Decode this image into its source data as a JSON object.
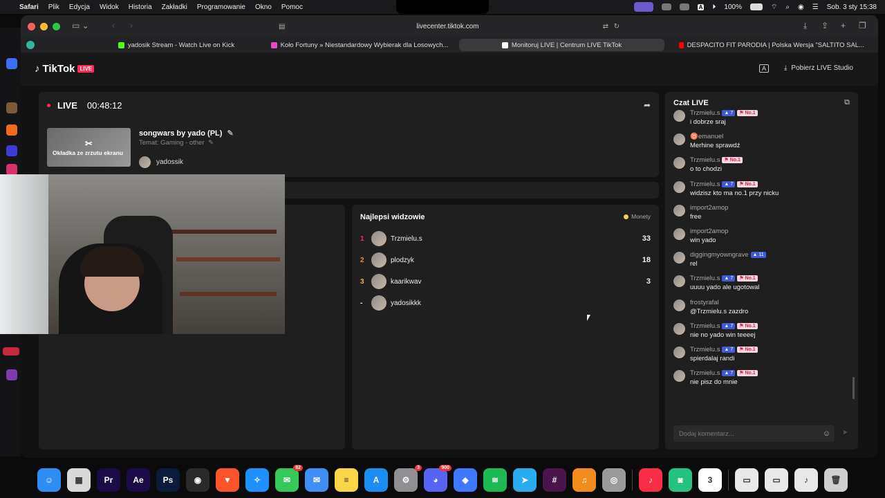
{
  "menubar": {
    "app": "Safari",
    "items": [
      "Plik",
      "Edycja",
      "Widok",
      "Historia",
      "Zakładki",
      "Programowanie",
      "Okno",
      "Pomoc"
    ],
    "battery": "100%",
    "datetime": "Sob. 3 sty 15:38"
  },
  "browser": {
    "url": "livecenter.tiktok.com",
    "tabs": [
      {
        "label": "yadosik Stream - Watch Live on Kick",
        "color": "#53fc18"
      },
      {
        "label": "Koło Fortuny » Niestandardowy Wybierak dla Losowych...",
        "color": "#e84ac2"
      },
      {
        "label": "Monitoruj LIVE | Centrum LIVE TikTok",
        "color": "#ffffff"
      },
      {
        "label": "DESPACITO FIT PARODIA | Polska Wersja \"SALTITO SAL...",
        "color": "#ff0000"
      }
    ]
  },
  "header": {
    "brand": "TikTok",
    "brand_badge": "LIVE",
    "download_label": "Pobierz LIVE Studio"
  },
  "live_panel": {
    "status": "LIVE",
    "timer": "00:48:12",
    "thumbnail_label": "Okładka ze zrzutu ekranu",
    "title": "songwars by yado (PL)",
    "topic": "Temat: Gaming - other",
    "username": "yadossik"
  },
  "top_viewers": {
    "title": "Najlepsi widzowie",
    "coins_label": "Monety",
    "rows": [
      {
        "rank": "1",
        "name": "Trzmielu.s",
        "score": "33",
        "rank_color": "#fe2c55"
      },
      {
        "rank": "2",
        "name": "plodzyk",
        "score": "18",
        "rank_color": "#ff8a3d"
      },
      {
        "rank": "3",
        "name": "kaarikwav",
        "score": "3",
        "rank_color": "#f5b82e"
      },
      {
        "rank": "-",
        "name": "yadosikkk",
        "score": "",
        "rank_color": "#ffffff"
      }
    ]
  },
  "chat": {
    "title": "Czat LIVE",
    "placeholder": "Dodaj komentarz...",
    "messages": [
      {
        "user": "Trzmielu.s",
        "level": "7",
        "badge": "No.1",
        "text": "i dobrze sraj"
      },
      {
        "user": "♉emanuel",
        "level": "",
        "badge": "",
        "text": "Merhine sprawdź"
      },
      {
        "user": "Trzmielu.s",
        "level": "",
        "badge": "No.1",
        "text": "o to chodzi"
      },
      {
        "user": "Trzmielu.s",
        "level": "7",
        "badge": "No.1",
        "text": "widzisz kto ma no.1 przy nicku"
      },
      {
        "user": "import2amop",
        "level": "",
        "badge": "",
        "text": "free"
      },
      {
        "user": "import2amop",
        "level": "",
        "badge": "",
        "text": "win yado"
      },
      {
        "user": "diggingmyowngrave",
        "level": "11",
        "badge": "",
        "text": "rel"
      },
      {
        "user": "Trzmielu.s",
        "level": "7",
        "badge": "No.1",
        "text": "uuuu yado ale ugotowal"
      },
      {
        "user": "frostyrafal",
        "level": "",
        "badge": "",
        "text": "@Trzmielu.s zazdro"
      },
      {
        "user": "Trzmielu.s",
        "level": "7",
        "badge": "No.1",
        "text": "nie no yado win teeeej"
      },
      {
        "user": "Trzmielu.s",
        "level": "7",
        "badge": "No.1",
        "text": "spierdalaj randi"
      },
      {
        "user": "Trzmielu.s",
        "level": "7",
        "badge": "No.1",
        "text": "nie pisz do mnie"
      }
    ]
  },
  "dock": {
    "apps": [
      {
        "name": "finder",
        "glyph": "☺",
        "color": "#2f8ef5"
      },
      {
        "name": "launchpad",
        "glyph": "▦",
        "color": "#d9d9d9"
      },
      {
        "name": "premiere",
        "glyph": "Pr",
        "color": "#1c0c46"
      },
      {
        "name": "after-effects",
        "glyph": "Ae",
        "color": "#1c0c46"
      },
      {
        "name": "photoshop",
        "glyph": "Ps",
        "color": "#0b1c3a"
      },
      {
        "name": "blender",
        "glyph": "◉",
        "color": "#2a2a2a"
      },
      {
        "name": "brave",
        "glyph": "▼",
        "color": "#fb542b"
      },
      {
        "name": "safari",
        "glyph": "✧",
        "color": "#1e90ff"
      },
      {
        "name": "messages",
        "glyph": "✉",
        "color": "#34c759",
        "badge": "82"
      },
      {
        "name": "mail",
        "glyph": "✉",
        "color": "#3d8ef5"
      },
      {
        "name": "notes",
        "glyph": "≡",
        "color": "#f9d648"
      },
      {
        "name": "app-store",
        "glyph": "A",
        "color": "#1b8df2"
      },
      {
        "name": "system-settings",
        "glyph": "⚙",
        "color": "#8e8e93",
        "badge": "3"
      },
      {
        "name": "discord",
        "glyph": "◕",
        "color": "#5865f2",
        "badge": "900"
      },
      {
        "name": "roblox",
        "glyph": "◆",
        "color": "#3f78ff"
      },
      {
        "name": "spotify",
        "glyph": "≋",
        "color": "#1db954"
      },
      {
        "name": "telegram",
        "glyph": "➤",
        "color": "#2aabee"
      },
      {
        "name": "slack",
        "glyph": "#",
        "color": "#4a154b"
      },
      {
        "name": "fl-studio",
        "glyph": "♫",
        "color": "#f28c1e"
      },
      {
        "name": "disk-utility",
        "glyph": "◎",
        "color": "#9a9a9a"
      },
      {
        "name": "music",
        "glyph": "♪",
        "color": "#fa2d48"
      },
      {
        "name": "gaming-app",
        "glyph": "◙",
        "color": "#26c281"
      },
      {
        "name": "calendar",
        "glyph": "3",
        "color": "#ffffff"
      },
      {
        "name": "document-1",
        "glyph": "▭",
        "color": "#e8e8e8"
      },
      {
        "name": "document-2",
        "glyph": "▭",
        "color": "#e8e8e8"
      },
      {
        "name": "audio-file",
        "glyph": "♪",
        "color": "#e8e8e8"
      },
      {
        "name": "trash",
        "glyph": "🗑",
        "color": "#cfcfcf"
      }
    ]
  }
}
